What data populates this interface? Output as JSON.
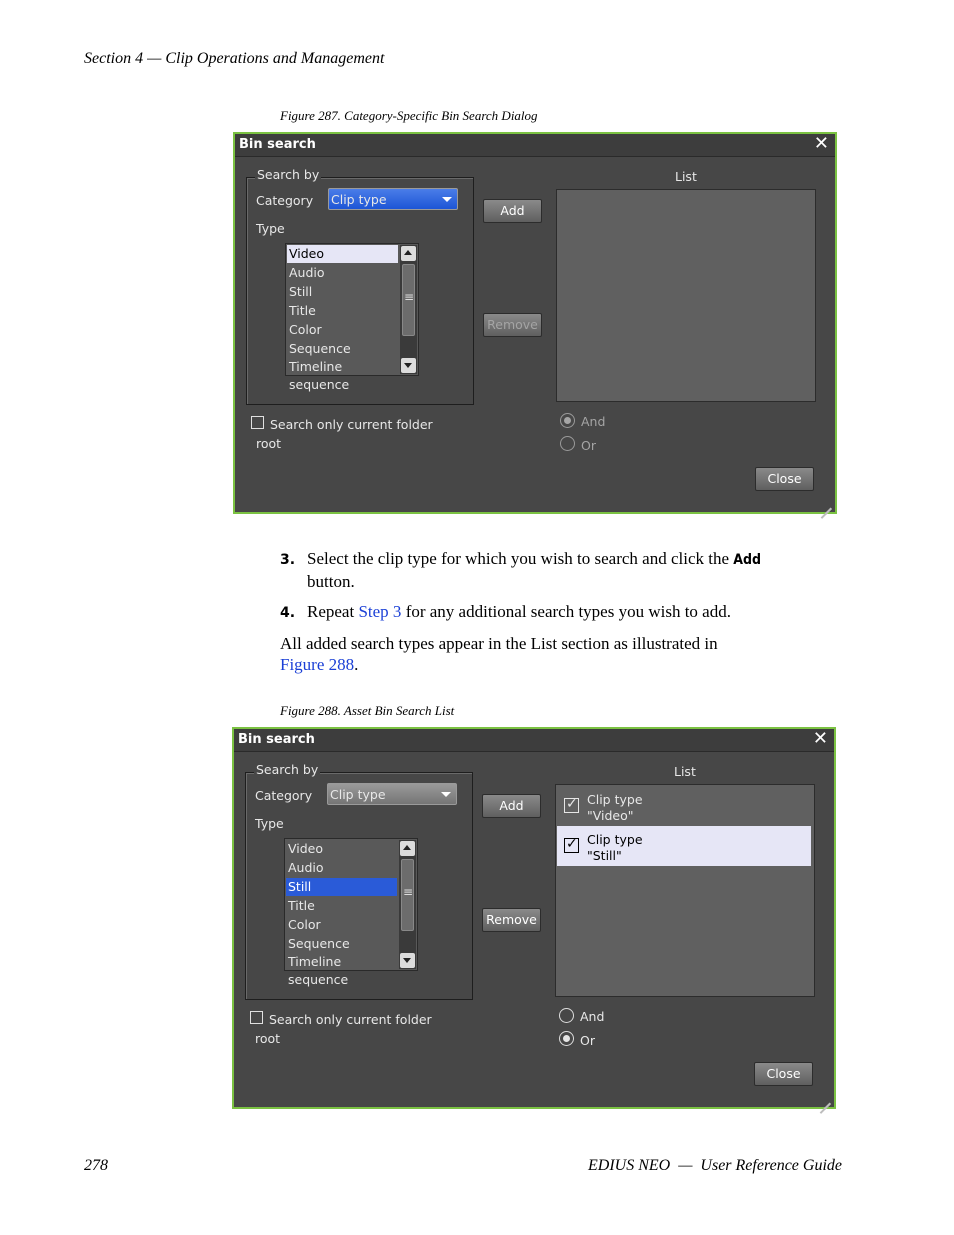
{
  "page": {
    "header": "Section 4 — Clip Operations and Management",
    "footer_left": "278",
    "footer_right": "EDIUS NEO  —  User Reference Guide"
  },
  "figure1": {
    "caption": "Figure 287.  Category-Specific Bin Search Dialog",
    "dialog": {
      "title": "Bin search",
      "close_icon": "close-x-icon",
      "search_by": "Search by",
      "category_label": "Category",
      "category_value": "Clip type",
      "type_label": "Type",
      "types": [
        "Video",
        "Audio",
        "Still",
        "Title",
        "Color",
        "Sequence",
        "Timeline sequence"
      ],
      "selected_type": "Video",
      "add": "Add",
      "remove": "Remove",
      "list_label": "List",
      "list_items": [],
      "search_current_folder": "Search only current folder",
      "folder": "root",
      "and": "And",
      "or": "Or",
      "logic_selected": "And",
      "close": "Close"
    }
  },
  "steps": [
    {
      "num": "3.",
      "text_before": "Select the clip type for which you wish to search and click the ",
      "kbd": "Add",
      "text_after": "button."
    },
    {
      "num": "4.",
      "text_before": "Repeat ",
      "link": "Step 3",
      "text_after": " for any additional search types you wish to add."
    }
  ],
  "paragraph": {
    "text": "All added search types appear in the List section as illustrated in",
    "link": "Figure 288",
    "end": "."
  },
  "figure2": {
    "caption": "Figure 288.  Asset Bin Search List",
    "dialog": {
      "title": "Bin search",
      "search_by": "Search by",
      "category_label": "Category",
      "category_value": "Clip type",
      "type_label": "Type",
      "types": [
        "Video",
        "Audio",
        "Still",
        "Title",
        "Color",
        "Sequence",
        "Timeline sequence"
      ],
      "selected_type": "Still",
      "add": "Add",
      "remove": "Remove",
      "list_label": "List",
      "list_items": [
        {
          "line1": "Clip type",
          "line2": "\"Video\"",
          "checked": true
        },
        {
          "line1": "Clip type",
          "line2": "\"Still\"",
          "checked": true
        }
      ],
      "search_current_folder": "Search only current folder",
      "folder": "root",
      "and": "And",
      "or": "Or",
      "logic_selected": "Or",
      "close": "Close"
    }
  }
}
